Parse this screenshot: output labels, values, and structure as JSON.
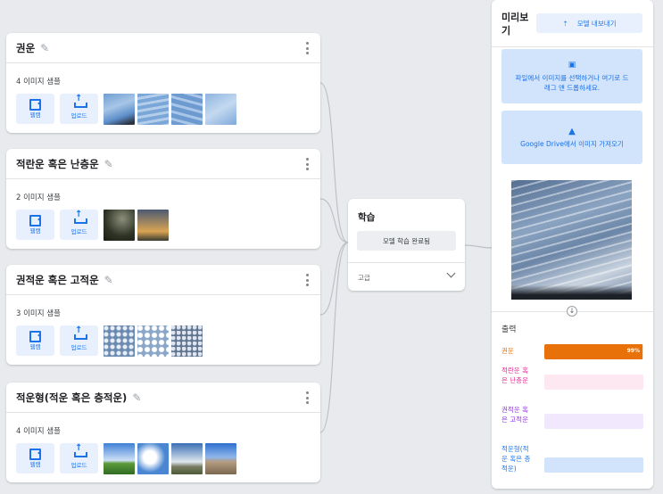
{
  "colors": {
    "accent": "#1a73e8",
    "class_colors": [
      "#e8710a",
      "#e52592",
      "#9334e6",
      "#1a73e8"
    ],
    "class_bar_bg": [
      "#fbe6cf",
      "#fde7f0",
      "#f1e8fd",
      "#d2e3fc"
    ]
  },
  "classes": [
    {
      "title": "권운",
      "sample_count": "4 이미지 샘플",
      "webcam_label": "웹캠",
      "upload_label": "업로드",
      "thumbs": [
        "t-cirrus1",
        "t-cirrus2",
        "t-cirrus3",
        "t-cirrus4"
      ]
    },
    {
      "title": "적란운 혹은 난층운",
      "sample_count": "2 이미지 샘플",
      "webcam_label": "웹캠",
      "upload_label": "업로드",
      "thumbs": [
        "t-nimbo1",
        "t-nimbo2"
      ]
    },
    {
      "title": "권적운 혹은 고적운",
      "sample_count": "3 이미지 샘플",
      "webcam_label": "웹캠",
      "upload_label": "업로드",
      "thumbs": [
        "t-alto1",
        "t-alto2",
        "t-alto3"
      ]
    },
    {
      "title": "적운형(적운 혹은 층적운)",
      "sample_count": "4 이미지 샘플",
      "webcam_label": "웹캠",
      "upload_label": "업로드",
      "thumbs": [
        "t-cumu1",
        "t-cumu2",
        "t-cumu3",
        "t-cumu4"
      ]
    }
  ],
  "training": {
    "title": "학습",
    "train_button": "모델 학습 완료됨",
    "advanced_label": "고급"
  },
  "preview": {
    "title": "미리보기",
    "export_button": "모델 내보내기",
    "drop_text": "파일에서 이미지를 선택하거나 여기로 드래그 앤 드롭하세요.",
    "drive_button": "Google Drive에서 이미지 가져오기",
    "output_title": "출력",
    "outputs": [
      {
        "label": "권운",
        "percent_text": "99%",
        "confidence": 0.99
      },
      {
        "label": "적란운 혹은 난층운",
        "percent_text": "",
        "confidence": 0.0
      },
      {
        "label": "권적운 혹은 고적운",
        "percent_text": "",
        "confidence": 0.0
      },
      {
        "label": "적운형(적운 혹은 층적운)",
        "percent_text": "",
        "confidence": 0.0
      }
    ]
  }
}
